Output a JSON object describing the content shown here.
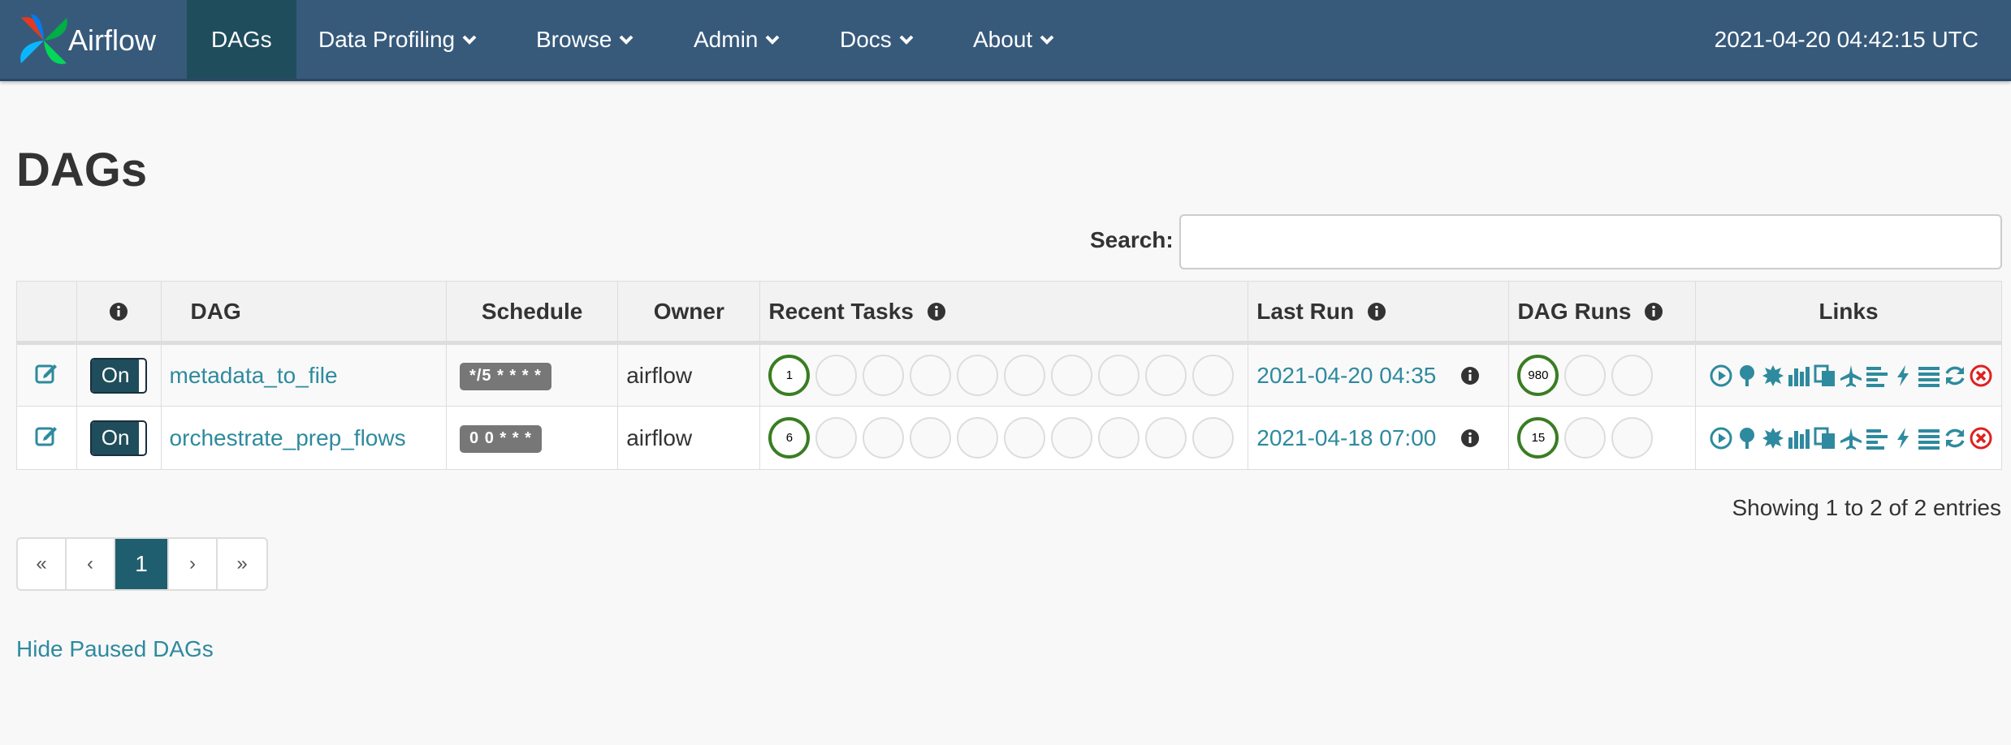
{
  "nav": {
    "brand": "Airflow",
    "items": [
      {
        "label": "DAGs"
      },
      {
        "label": "Data Profiling"
      },
      {
        "label": "Browse"
      },
      {
        "label": "Admin"
      },
      {
        "label": "Docs"
      },
      {
        "label": "About"
      }
    ],
    "clock": "2021-04-20 04:42:15 UTC"
  },
  "page": {
    "title": "DAGs",
    "search_label": "Search:",
    "search_value": "",
    "showing": "Showing 1 to 2 of 2 entries",
    "hide_paused": "Hide Paused DAGs"
  },
  "table": {
    "headers": {
      "dag": "DAG",
      "schedule": "Schedule",
      "owner": "Owner",
      "recent_tasks": "Recent Tasks",
      "last_run": "Last Run",
      "dag_runs": "DAG Runs",
      "links": "Links"
    },
    "rows": [
      {
        "toggle": "On",
        "dag_id": "metadata_to_file",
        "schedule": "*/5 * * * *",
        "owner": "airflow",
        "recent_tasks_success": "1",
        "last_run": "2021-04-20 04:35",
        "dag_runs_success": "980"
      },
      {
        "toggle": "On",
        "dag_id": "orchestrate_prep_flows",
        "schedule": "0 0 * * *",
        "owner": "airflow",
        "recent_tasks_success": "6",
        "last_run": "2021-04-18 07:00",
        "dag_runs_success": "15"
      }
    ]
  },
  "pagination": {
    "first": "«",
    "prev": "‹",
    "current": "1",
    "next": "›",
    "last": "»"
  },
  "colors": {
    "navbar": "#375a7b",
    "active_nav": "#1f4d5c",
    "link": "#2e8a9e",
    "success": "#3a7d23",
    "failed": "#e02020"
  },
  "icons": {
    "links": [
      "trigger-dag-icon",
      "tree-view-icon",
      "graph-view-icon",
      "task-duration-icon",
      "task-tries-icon",
      "landing-times-icon",
      "gantt-icon",
      "code-icon",
      "logs-icon",
      "refresh-icon",
      "delete-icon"
    ]
  }
}
